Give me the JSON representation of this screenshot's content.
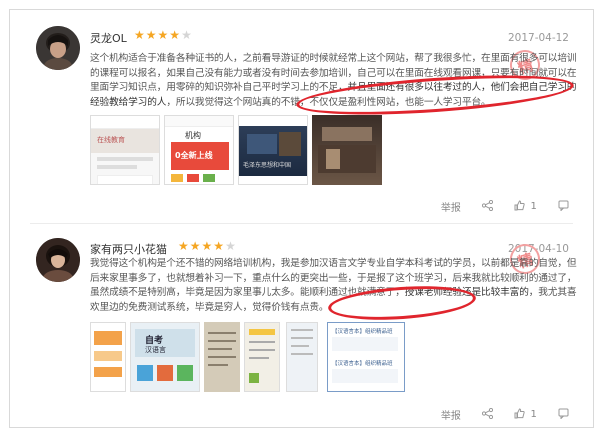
{
  "reviews": [
    {
      "user": "灵龙OL",
      "rating": 4,
      "date": "2017-04-12",
      "stamp": "精",
      "text_before": "这个机构适合于准备各种证书的人，之前看导游证的时候就经常上这个网站，帮了我很多忙，在里面有很多可以培训的课程可以报名，如果自己没有能力或者没有时间去参加培训，自己可以在里面在线观看网课，只要有时间就可以在里面学习知识点，用零碎的知识弥补自己平时学习上的不足，",
      "text_highlight": "并且里面还有很多以往考过的人，他们会把自己学习的经验教给学习的人",
      "text_after": "，所以我觉得这个网站真的不错，不仅仅是盈利性网站，也能一人学习平台。",
      "thumbs": [
        {
          "line1": "在线教育",
          "line2": ""
        },
        {
          "line1": "机构",
          "line2": "0全新上线"
        },
        {
          "line1": "",
          "line2": "毛泽东思想和中国"
        },
        {
          "line1": "",
          "line2": ""
        }
      ],
      "report_label": "举报",
      "share_icon": "share-icon",
      "like_count": "1",
      "comment_icon": "comment-icon"
    },
    {
      "user": "家有两只小花猫",
      "rating": 4,
      "date": "2017-04-10",
      "stamp": "精",
      "text_before": "我觉得这个机构是个还不错的网络培训机构，我是参加汉语言文学专业自学本科考试的学员，以前都是靠的自觉，但后来家里事多了，也就想着补习一下，重点什么的更突出一些，于是报了这个班学习，后来我就比较顺利的通过了，虽然成绩不是特别高，毕竟是因为家里事儿太多。能顺利通过也就满意了，",
      "text_highlight": "授课老师经验还是比较丰富的",
      "text_after": "，我尤其喜欢里边的免费测试系统，毕竟是穷人，觉得价钱有点贵。",
      "thumbs": [
        {
          "line1": "",
          "line2": ""
        },
        {
          "line1": "自考",
          "line2": "汉语言"
        },
        {
          "line1": "",
          "line2": ""
        },
        {
          "line1": "",
          "line2": ""
        },
        {
          "line1": "【汉语言本】组织精品班",
          "line2": "【汉语言本】组织精品班"
        }
      ],
      "report_label": "举报",
      "share_icon": "share-icon",
      "like_count": "1",
      "comment_icon": "comment-icon"
    }
  ],
  "colors": {
    "star": "#f5a623",
    "annotation": "#e0252d",
    "stamp": "#f08a8a"
  }
}
